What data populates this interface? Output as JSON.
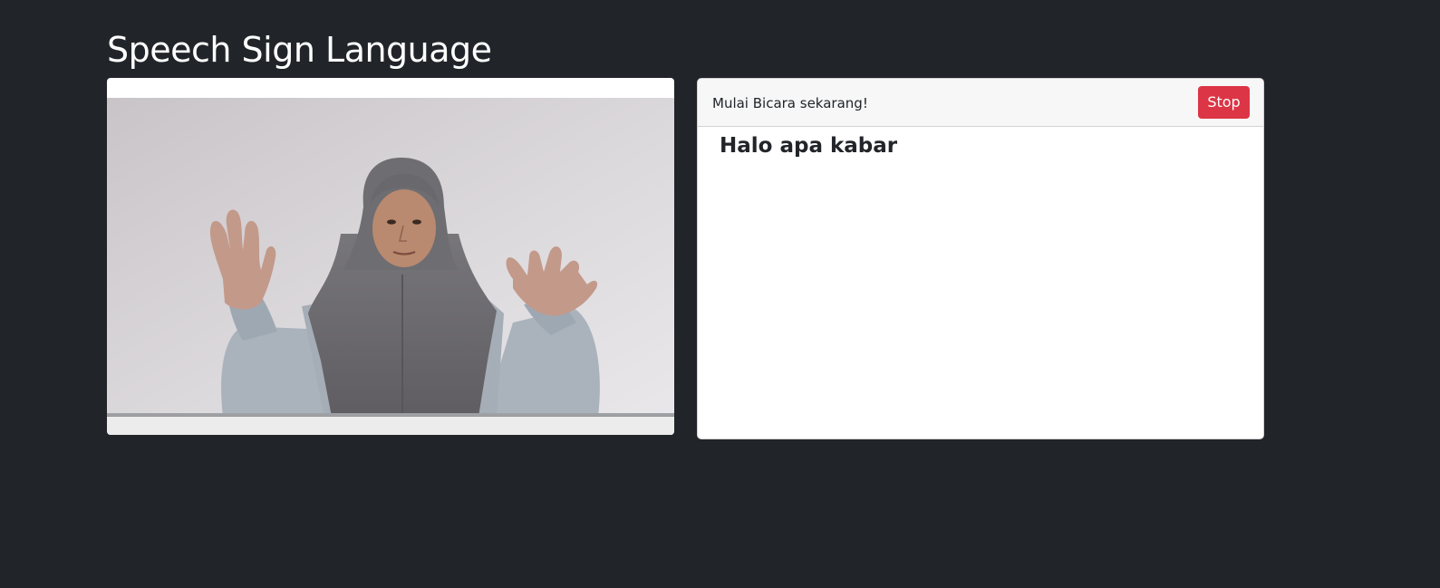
{
  "header": {
    "title": "Speech Sign Language"
  },
  "video_panel": {
    "content": "video of a person in a grey hijab signing with both hands raised"
  },
  "speech_panel": {
    "status_text": "Mulai Bicara sekarang!",
    "stop_label": "Stop",
    "transcript": "Halo apa kabar"
  },
  "colors": {
    "page_background": "#212529",
    "stop_button": "#dc3545",
    "card_header": "#f7f7f7",
    "text_dark": "#212529"
  }
}
